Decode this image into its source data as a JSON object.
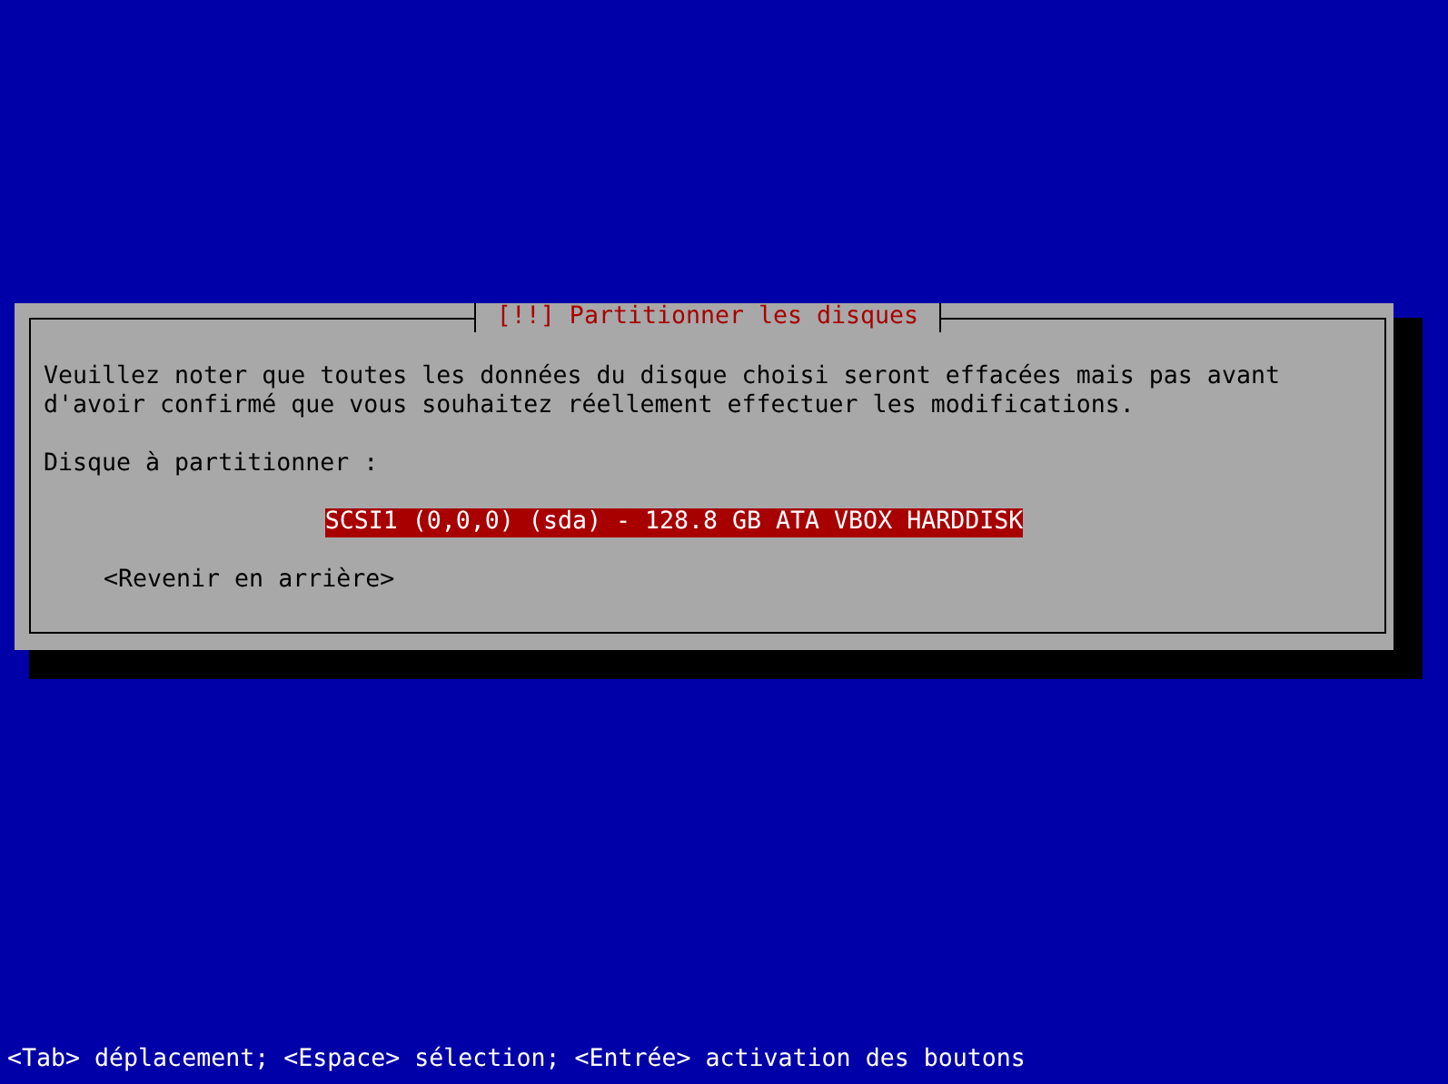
{
  "dialog": {
    "title": "[!!] Partitionner les disques",
    "message": "Veuillez noter que toutes les données du disque choisi seront effacées mais pas avant d'avoir confirmé que vous souhaitez réellement effectuer les modifications.",
    "prompt": "Disque à partitionner :",
    "disks": [
      {
        "label": "SCSI1 (0,0,0) (sda) - 128.8 GB ATA VBOX HARDDISK",
        "selected": true
      }
    ],
    "back_button": "<Revenir en arrière>"
  },
  "status_bar": "<Tab> déplacement; <Espace> sélection; <Entrée> activation des boutons"
}
